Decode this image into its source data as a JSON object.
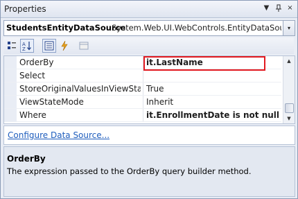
{
  "window": {
    "title": "Properties",
    "dropdown_icon": "▼",
    "pin_icon": "pin-icon",
    "close_icon": "×"
  },
  "object_selector": {
    "name": "StudentsEntityDataSource",
    "type": "System.Web.UI.WebControls.EntityDataSource",
    "arrow": "▾"
  },
  "toolbar": {
    "buttons": [
      {
        "name": "categorized-icon",
        "glyph": "☷"
      },
      {
        "name": "alphabetical-icon",
        "glyph": "A↓"
      },
      {
        "name": "properties-icon",
        "glyph": "▤"
      },
      {
        "name": "events-icon",
        "glyph": "⚡"
      },
      {
        "name": "property-pages-icon",
        "glyph": "▭"
      }
    ]
  },
  "properties": [
    {
      "name": "OrderBy",
      "value": "it.LastName",
      "bold": true,
      "highlighted": true
    },
    {
      "name": "Select",
      "value": "",
      "bold": false
    },
    {
      "name": "StoreOriginalValuesInViewState",
      "value": "True",
      "bold": false
    },
    {
      "name": "ViewStateMode",
      "value": "Inherit",
      "bold": false
    },
    {
      "name": "Where",
      "value": "it.EnrollmentDate is not null",
      "bold": true
    }
  ],
  "commands": {
    "link": "Configure Data Source..."
  },
  "description": {
    "title": "OrderBy",
    "text": "The expression passed to the OrderBy query builder method."
  },
  "colors": {
    "highlight_border": "#e2191f",
    "link": "#1e5dbd"
  }
}
